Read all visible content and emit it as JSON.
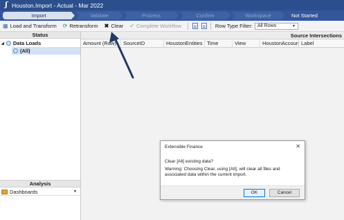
{
  "titlebar": {
    "title": "Houston.Import  -  Actual  -  Mar 2022"
  },
  "workflow": {
    "steps": [
      "Import",
      "Validate",
      "Process",
      "Confirm",
      "Workspace"
    ],
    "status": "Not Started"
  },
  "toolbar": {
    "load_transform": "Load and Transform",
    "retransform": "Retransform",
    "clear": "Clear",
    "complete_workflow": "Complete Workflow",
    "row_type_filter_label": "Row Type Filter:",
    "row_type_filter_value": "All Rows"
  },
  "left_panel": {
    "status_header": "Status",
    "tree_root": "Data Loads",
    "tree_child": "(All)",
    "analysis_header": "Analysis",
    "dashboards": "Dashboards"
  },
  "grid": {
    "section_label": "Source Intersections",
    "columns": [
      "Amount (Raw)",
      "SourceID",
      "HoustonEntities",
      "Time",
      "View",
      "HoustonAccount",
      "Label"
    ]
  },
  "dialog": {
    "title": "Extensible Finance",
    "question": "Clear [All] existing data?",
    "warning": "Warning: Choosing Clear, using [All], will clear all files and associated data within the current import.",
    "ok": "OK",
    "cancel": "Cancel"
  },
  "colors": {
    "titlebar": "#2b4f8c",
    "steps_bar": "#33579a",
    "active_step": "#d7e1ef",
    "annotation_arrow": "#1f3a66"
  }
}
